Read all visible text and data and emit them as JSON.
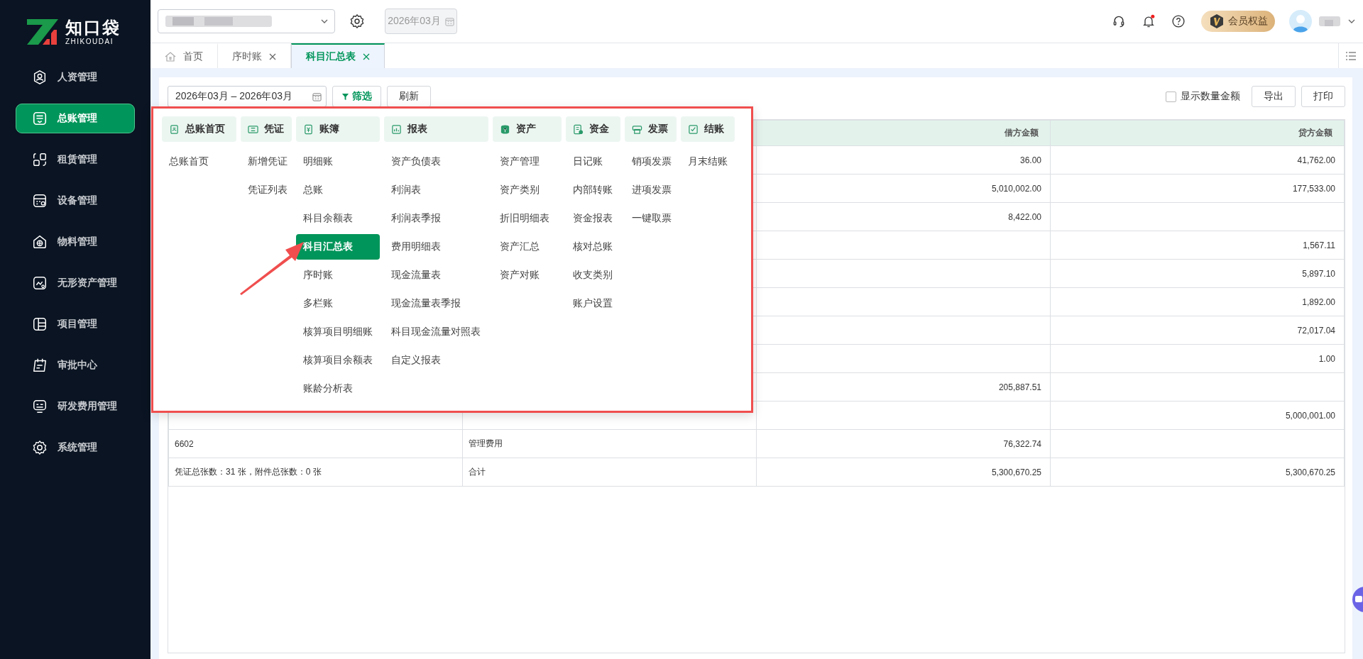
{
  "sidebar": {
    "logo": {
      "name": "知口袋",
      "subtitle": "ZHIKOUDAI"
    },
    "items": [
      {
        "label": "人资管理",
        "selected": false
      },
      {
        "label": "总账管理",
        "selected": true
      },
      {
        "label": "租赁管理",
        "selected": false
      },
      {
        "label": "设备管理",
        "selected": false
      },
      {
        "label": "物料管理",
        "selected": false
      },
      {
        "label": "无形资产管理",
        "selected": false
      },
      {
        "label": "项目管理",
        "selected": false
      },
      {
        "label": "审批中心",
        "selected": false
      },
      {
        "label": "研发费用管理",
        "selected": false
      },
      {
        "label": "系统管理",
        "selected": false
      }
    ]
  },
  "header": {
    "period": "2026年03月",
    "notifications_unread": true,
    "member_badge": "会员权益"
  },
  "tabs": [
    {
      "label": "首页",
      "kind": "home",
      "closable": false,
      "selected": false
    },
    {
      "label": "序时账",
      "kind": "page",
      "closable": true,
      "selected": false
    },
    {
      "label": "科目汇总表",
      "kind": "page",
      "closable": true,
      "selected": true
    }
  ],
  "toolbar": {
    "date_range": "2026年03月 – 2026年03月",
    "filter_button": "筛选",
    "refresh_button": "刷新",
    "show_quantity": {
      "label": "显示数量金额",
      "checked": false
    },
    "export_button": "导出",
    "print_button": "打印"
  },
  "table": {
    "columns": [
      {
        "label": "借方金额"
      },
      {
        "label": "贷方金额"
      }
    ],
    "rows": [
      {
        "debit": "36.00",
        "credit": "41,762.00"
      },
      {
        "debit": "5,010,002.00",
        "credit": "177,533.00"
      },
      {
        "debit": "8,422.00"
      },
      {
        "credit": "1,567.11"
      },
      {
        "credit": "5,897.10"
      },
      {
        "credit": "1,892.00"
      },
      {
        "credit": "72,017.04"
      },
      {
        "credit": "1.00"
      },
      {
        "debit": "205,887.51"
      },
      {
        "credit": "5,000,001.00"
      },
      {
        "code": "6602",
        "name": "管理费用",
        "debit": "76,322.74"
      },
      {
        "code": "凭证总张数：31 张，附件总张数：0 张",
        "name": "合计",
        "debit": "5,300,670.25",
        "credit": "5,300,670.25"
      }
    ]
  },
  "menu": {
    "columns": [
      {
        "title": "总账首页",
        "items": [
          {
            "label": "总账首页",
            "selected": false
          }
        ]
      },
      {
        "title": "凭证",
        "items": [
          {
            "label": "新增凭证",
            "selected": false
          },
          {
            "label": "凭证列表",
            "selected": false
          }
        ]
      },
      {
        "title": "账簿",
        "items": [
          {
            "label": "明细账",
            "selected": false
          },
          {
            "label": "总账",
            "selected": false
          },
          {
            "label": "科目余额表",
            "selected": false
          },
          {
            "label": "科目汇总表",
            "selected": true
          },
          {
            "label": "序时账",
            "selected": false
          },
          {
            "label": "多栏账",
            "selected": false
          },
          {
            "label": "核算项目明细账",
            "selected": false
          },
          {
            "label": "核算项目余额表",
            "selected": false
          },
          {
            "label": "账龄分析表",
            "selected": false
          }
        ]
      },
      {
        "title": "报表",
        "items": [
          {
            "label": "资产负债表",
            "selected": false
          },
          {
            "label": "利润表",
            "selected": false
          },
          {
            "label": "利润表季报",
            "selected": false
          },
          {
            "label": "费用明细表",
            "selected": false
          },
          {
            "label": "现金流量表",
            "selected": false
          },
          {
            "label": "现金流量表季报",
            "selected": false
          },
          {
            "label": "科目现金流量对照表",
            "selected": false
          },
          {
            "label": "自定义报表",
            "selected": false
          }
        ]
      },
      {
        "title": "资产",
        "items": [
          {
            "label": "资产管理",
            "selected": false
          },
          {
            "label": "资产类别",
            "selected": false
          },
          {
            "label": "折旧明细表",
            "selected": false
          },
          {
            "label": "资产汇总",
            "selected": false
          },
          {
            "label": "资产对账",
            "selected": false
          }
        ]
      },
      {
        "title": "资金",
        "items": [
          {
            "label": "日记账",
            "selected": false
          },
          {
            "label": "内部转账",
            "selected": false
          },
          {
            "label": "资金报表",
            "selected": false
          },
          {
            "label": "核对总账",
            "selected": false
          },
          {
            "label": "收支类别",
            "selected": false
          },
          {
            "label": "账户设置",
            "selected": false
          }
        ]
      },
      {
        "title": "发票",
        "items": [
          {
            "label": "销项发票",
            "selected": false
          },
          {
            "label": "进项发票",
            "selected": false
          },
          {
            "label": "一键取票",
            "selected": false
          }
        ]
      },
      {
        "title": "结账",
        "items": [
          {
            "label": "月末结账",
            "selected": false
          }
        ]
      }
    ]
  }
}
